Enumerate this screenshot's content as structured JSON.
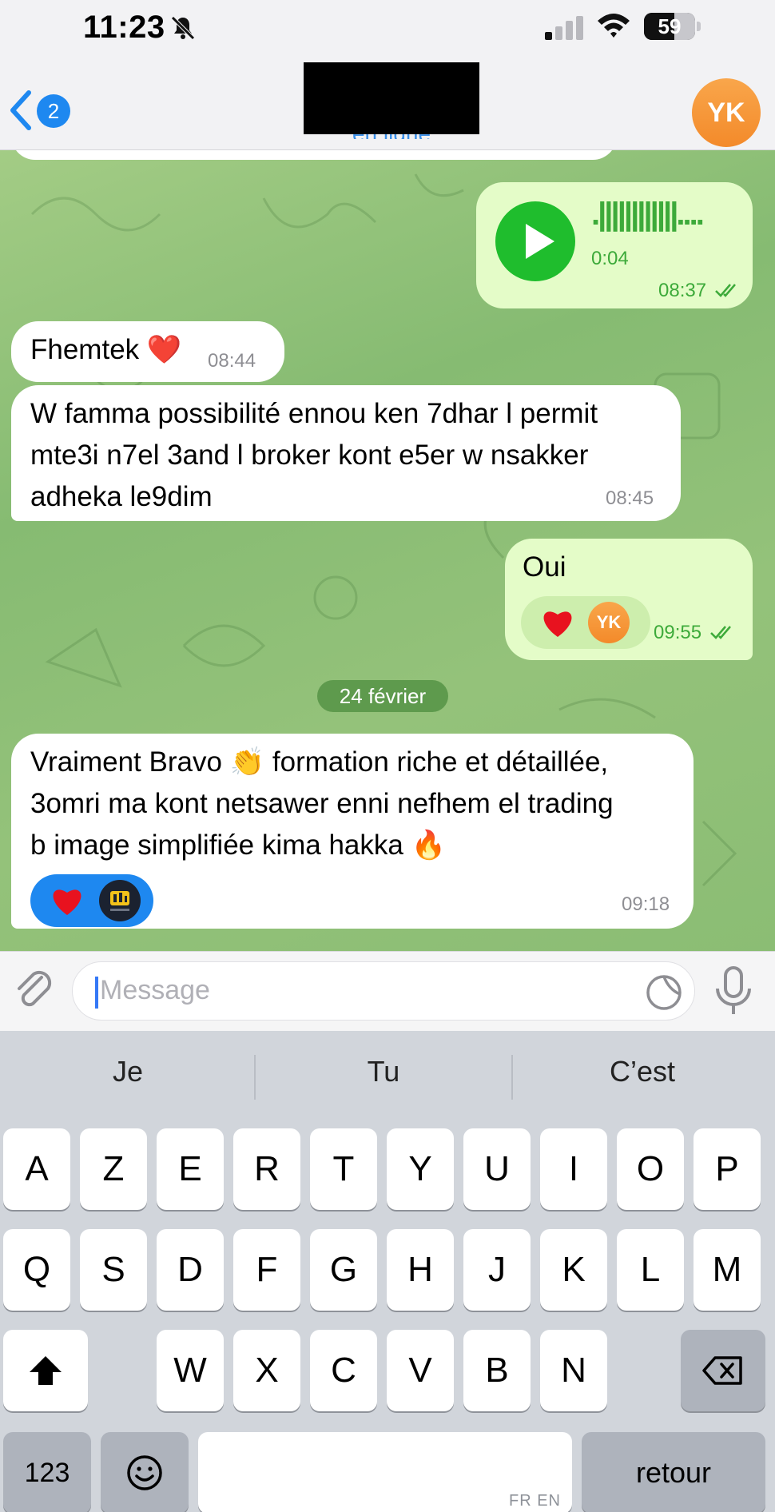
{
  "status_bar": {
    "time": "11:23",
    "battery": "59",
    "battery_level": 0.59
  },
  "header": {
    "back_count": "2",
    "subtitle": "en ligne",
    "avatar_initials": "YK"
  },
  "messages": [
    {
      "side": "out",
      "type": "voice",
      "duration": "0:04",
      "waveform": ".||||||||||||....",
      "time": "08:37",
      "read": true
    },
    {
      "side": "in",
      "text": "Fhemtek ❤️",
      "time": "08:44"
    },
    {
      "side": "in",
      "lines": [
        "W famma possibilité ennou ken 7dhar l permit",
        "mte3i n7el 3and l broker kont e5er w nsakker",
        "adheka le9dim"
      ],
      "time": "08:45"
    },
    {
      "side": "out",
      "text": "Oui",
      "time": "09:55",
      "read": true,
      "reactions": [
        "heart",
        "YK"
      ]
    },
    {
      "side": "in",
      "lines": [
        "Vraiment Bravo 👏 formation riche et détaillée,",
        "3omri ma kont netsawer enni nefhem el trading",
        "b image simplifiée kima hakka 🔥"
      ],
      "time": "09:18",
      "reactions": [
        "heart",
        "logo"
      ]
    }
  ],
  "date_separator": "24 février",
  "composer": {
    "placeholder": "Message"
  },
  "keyboard": {
    "suggestions": [
      "Je",
      "Tu",
      "C’est"
    ],
    "row1": [
      "A",
      "Z",
      "E",
      "R",
      "T",
      "Y",
      "U",
      "I",
      "O",
      "P"
    ],
    "row2": [
      "Q",
      "S",
      "D",
      "F",
      "G",
      "H",
      "J",
      "K",
      "L",
      "M"
    ],
    "row3": [
      "W",
      "X",
      "C",
      "V",
      "B",
      "N"
    ],
    "numbers_label": "123",
    "return_label": "retour",
    "language_hint": "FR EN"
  },
  "colors": {
    "accent": "#1e88f0",
    "outgoing_bubble": "#e4fcc8",
    "incoming_bubble": "#ffffff",
    "chat_bg": "#8bbd74",
    "avatar": "#f39a3a"
  }
}
